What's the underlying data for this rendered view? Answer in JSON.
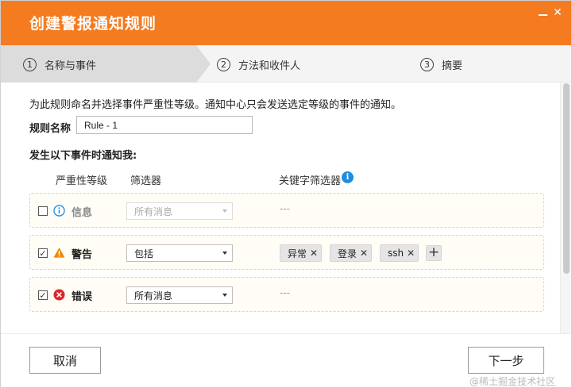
{
  "dialog": {
    "title": "创建警报通知规则"
  },
  "steps": [
    {
      "num": "1",
      "label": "名称与事件"
    },
    {
      "num": "2",
      "label": "方法和收件人"
    },
    {
      "num": "3",
      "label": "摘要"
    }
  ],
  "form": {
    "description": "为此规则命名并选择事件严重性等级。通知中心只会发送选定等级的事件的通知。",
    "rule_name_label": "规则名称",
    "rule_name_value": "Rule - 1",
    "section_label": "发生以下事件时通知我:"
  },
  "columns": {
    "severity": "严重性等级",
    "filter": "筛选器",
    "keyword_filter": "关键字筛选器"
  },
  "rows": [
    {
      "checked": false,
      "icon": "info-icon",
      "label": "信息",
      "filter": "所有消息",
      "disabled": true,
      "placeholder": "---",
      "tags": []
    },
    {
      "checked": true,
      "icon": "warning-icon",
      "label": "警告",
      "filter": "包括",
      "disabled": false,
      "tags": [
        "异常",
        "登录",
        "ssh"
      ]
    },
    {
      "checked": true,
      "icon": "error-icon",
      "label": "错误",
      "filter": "所有消息",
      "disabled": false,
      "placeholder": "---",
      "tags": []
    }
  ],
  "buttons": {
    "cancel": "取消",
    "next": "下一步"
  },
  "watermark": "@稀土掘金技术社区",
  "colors": {
    "accent": "#f47b20",
    "info": "#1f8ce0",
    "warning": "#f08a00",
    "error": "#d9262c"
  }
}
